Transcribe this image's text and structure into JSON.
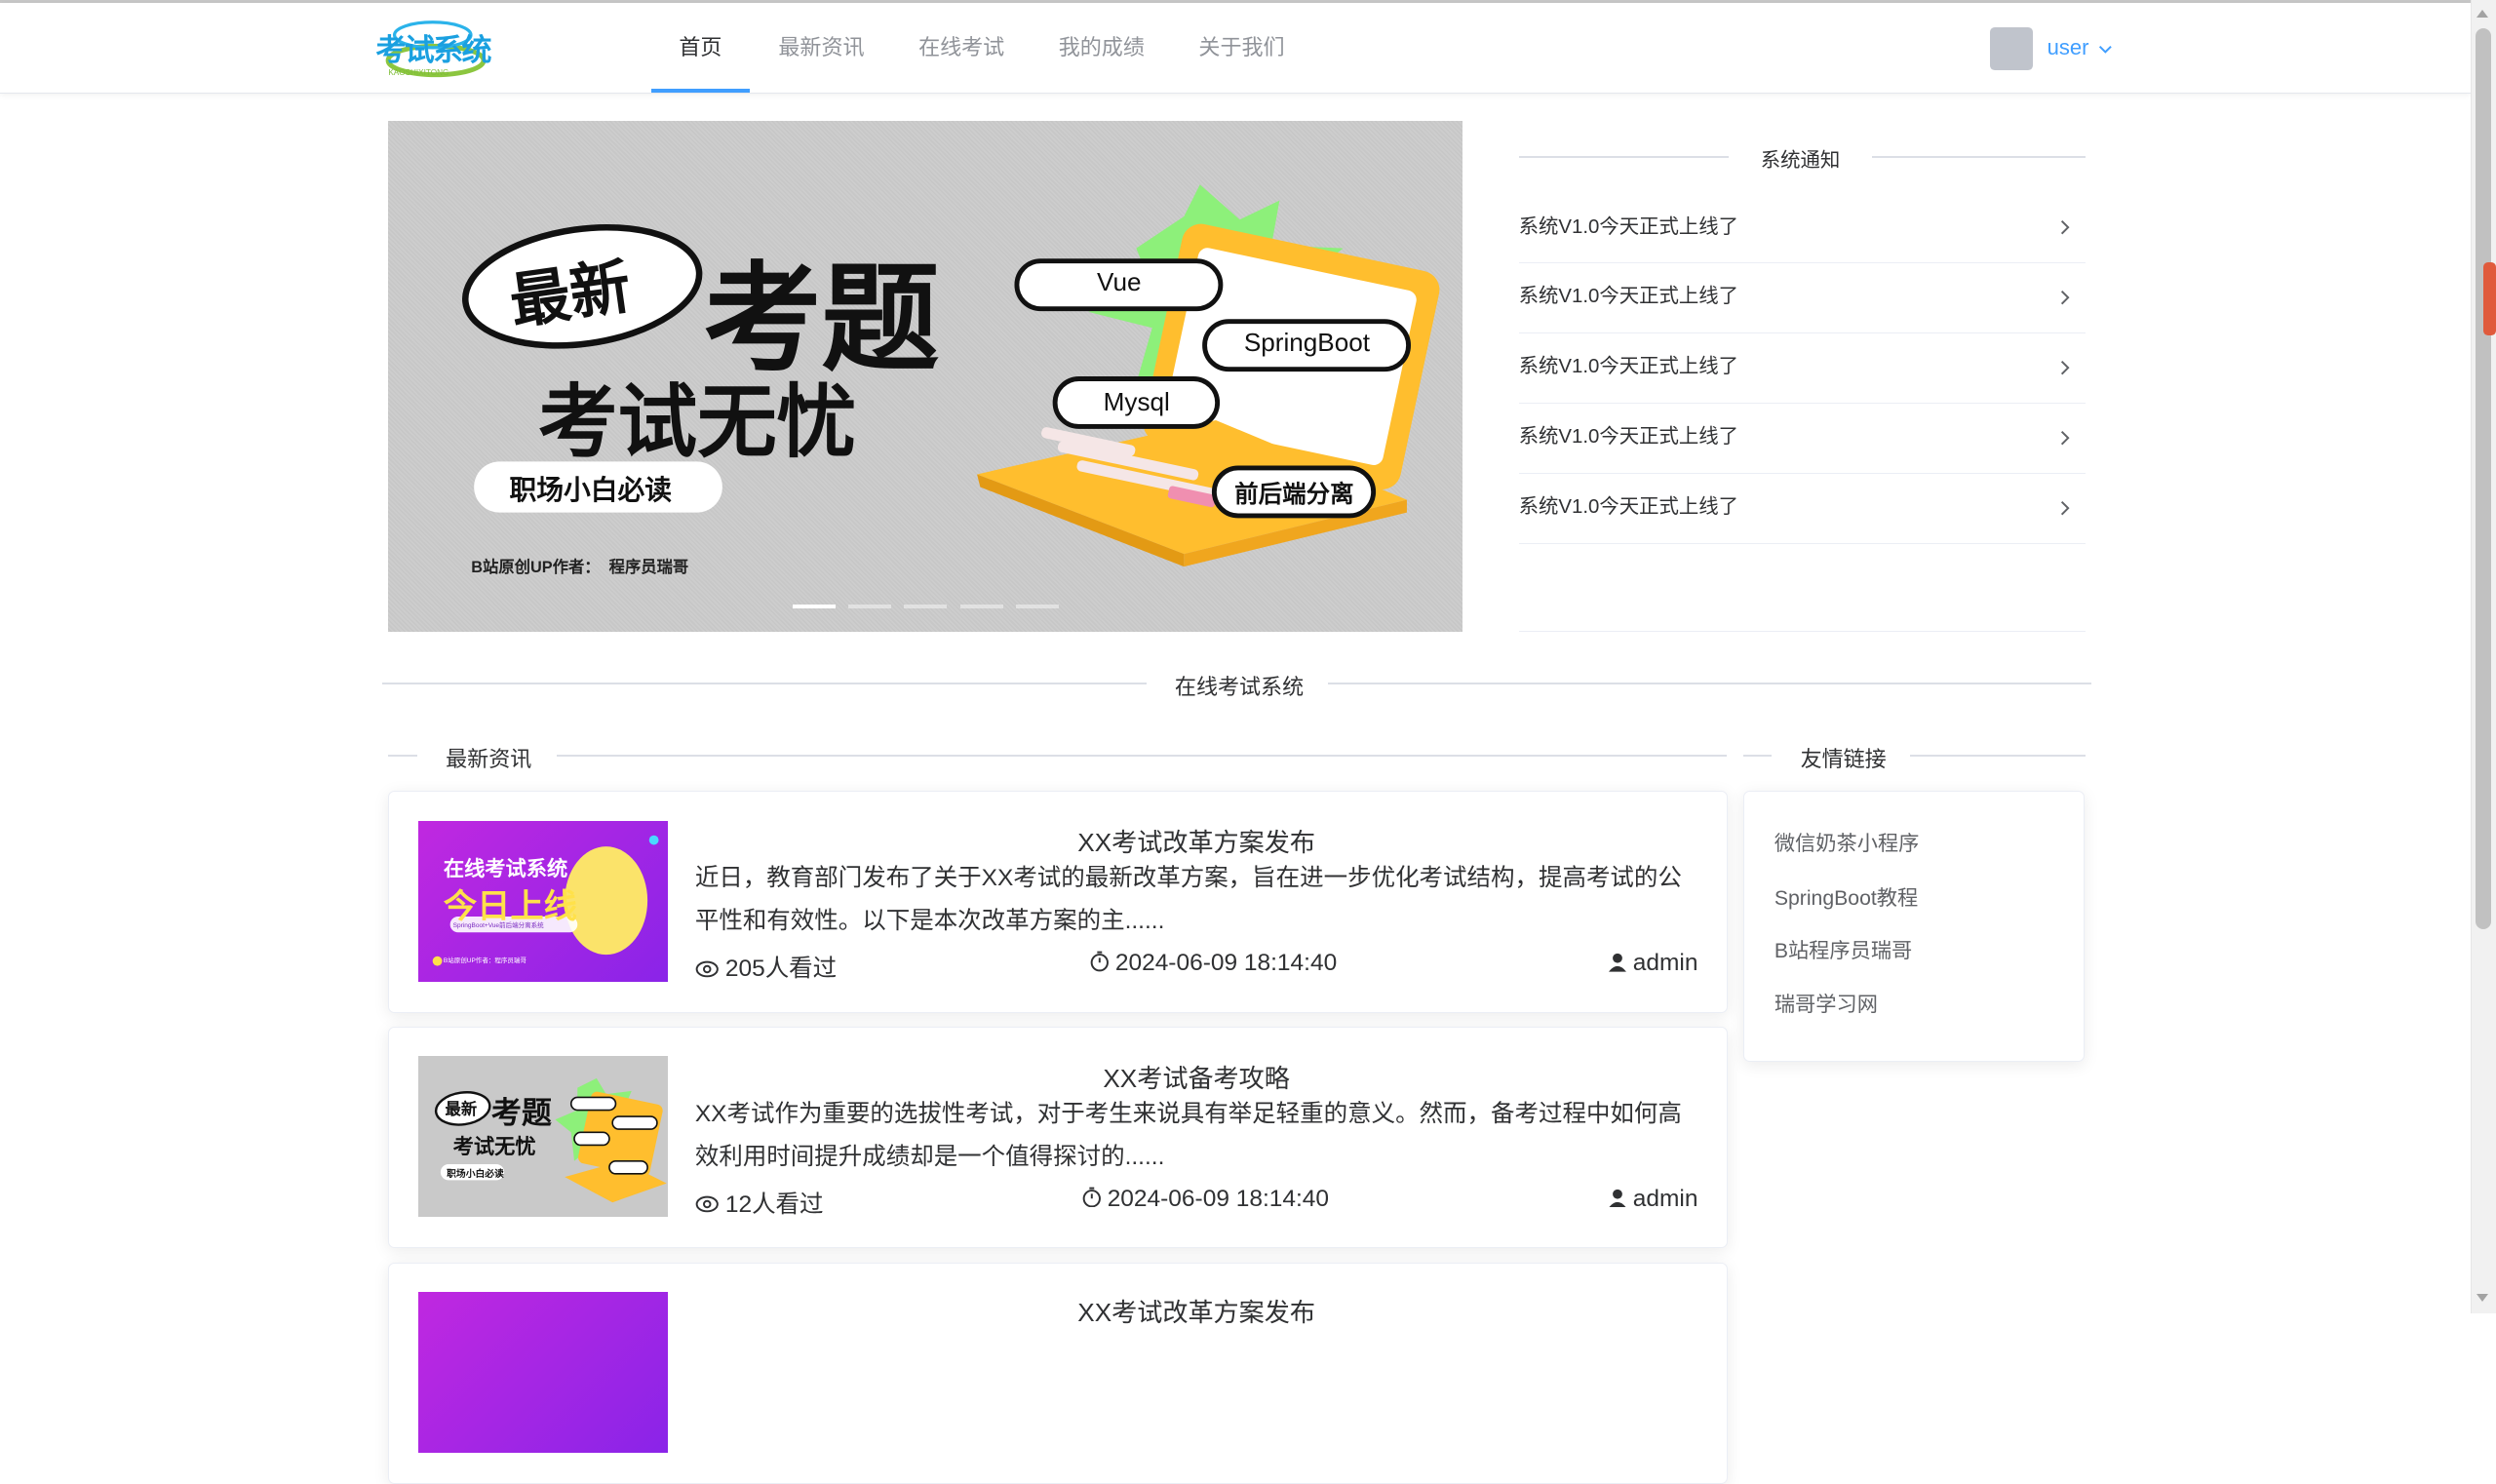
{
  "header": {
    "logo_text": "考试系统",
    "logo_sub": "KAOSHIXITONG",
    "nav": [
      {
        "label": "首页",
        "active": true
      },
      {
        "label": "最新资讯",
        "active": false
      },
      {
        "label": "在线考试",
        "active": false
      },
      {
        "label": "我的成绩",
        "active": false
      },
      {
        "label": "关于我们",
        "active": false
      }
    ],
    "user": "user"
  },
  "banner": {
    "badge": "最新",
    "headline": "考题",
    "subheadline": "考试无忧",
    "pill": "职场小白必读",
    "author": "B站原创UP作者：  程序员瑞哥",
    "tags": [
      "Vue",
      "SpringBoot",
      "Mysql",
      "前后端分离"
    ],
    "slide_count": 5,
    "active_slide": 1
  },
  "notices": {
    "title": "系统通知",
    "items": [
      "系统V1.0今天正式上线了",
      "系统V1.0今天正式上线了",
      "系统V1.0今天正式上线了",
      "系统V1.0今天正式上线了",
      "系统V1.0今天正式上线了"
    ]
  },
  "section_title": "在线考试系统",
  "news": {
    "title": "最新资讯",
    "items": [
      {
        "title": "XX考试改革方案发布",
        "summary": "近日，教育部门发布了关于XX考试的最新改革方案，旨在进一步优化考试结构，提高考试的公平性和有效性。以下是本次改革方案的主......",
        "views": "205人看过",
        "time": "2024-06-09 18:14:40",
        "author": "admin",
        "thumb": {
          "line1": "在线考试系统",
          "line2": "今日上线",
          "small": "SpringBoot+Vue前后端分离系统",
          "foot": "B站原创UP作者：程序员瑞哥"
        }
      },
      {
        "title": "XX考试备考攻略",
        "summary": "XX考试作为重要的选拔性考试，对于考生来说具有举足轻重的意义。然而，备考过程中如何高效利用时间提升成绩却是一个值得探讨的......",
        "views": "12人看过",
        "time": "2024-06-09 18:14:40",
        "author": "admin",
        "thumb": {
          "line1": "最新",
          "line2": "考题",
          "line3": "考试无忧",
          "pill": "职场小白必读"
        }
      },
      {
        "title": "XX考试改革方案发布"
      }
    ]
  },
  "links": {
    "title": "友情链接",
    "items": [
      "微信奶茶小程序",
      "SpringBoot教程",
      "B站程序员瑞哥",
      "瑞哥学习网"
    ]
  },
  "colors": {
    "accent": "#409eff",
    "thumb_purple": "#a52bdf",
    "banner_bg": "#c9c9c9",
    "laptop_yellow": "#ffbe2e",
    "burst_green": "#8df07a"
  }
}
